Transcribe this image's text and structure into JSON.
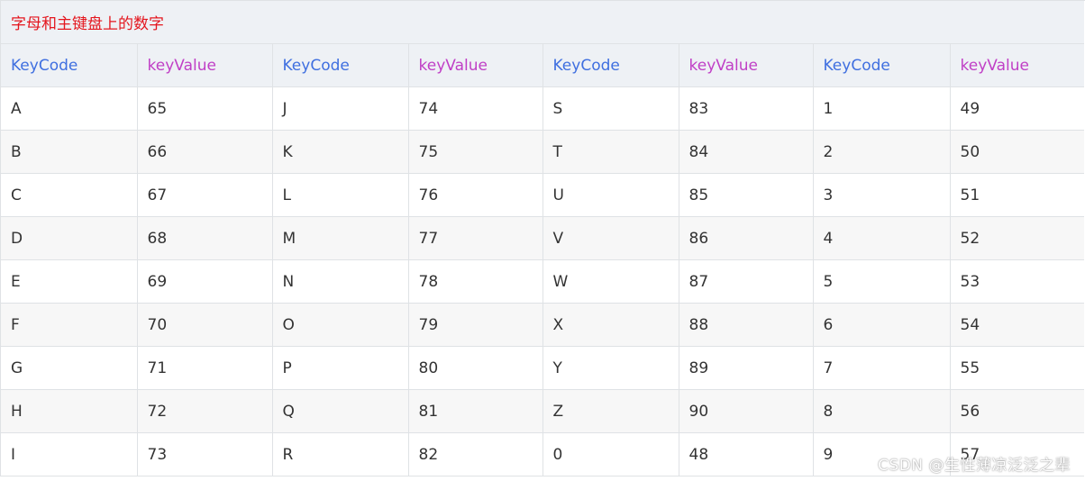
{
  "title": "字母和主键盘上的数字",
  "headers": [
    "KeyCode",
    "keyValue",
    "KeyCode",
    "keyValue",
    "KeyCode",
    "keyValue",
    "KeyCode",
    "keyValue"
  ],
  "rows": [
    [
      "A",
      "65",
      "J",
      "74",
      "S",
      "83",
      "1",
      "49"
    ],
    [
      "B",
      "66",
      "K",
      "75",
      "T",
      "84",
      "2",
      "50"
    ],
    [
      "C",
      "67",
      "L",
      "76",
      "U",
      "85",
      "3",
      "51"
    ],
    [
      "D",
      "68",
      "M",
      "77",
      "V",
      "86",
      "4",
      "52"
    ],
    [
      "E",
      "69",
      "N",
      "78",
      "W",
      "87",
      "5",
      "53"
    ],
    [
      "F",
      "70",
      "O",
      "79",
      "X",
      "88",
      "6",
      "54"
    ],
    [
      "G",
      "71",
      "P",
      "80",
      "Y",
      "89",
      "7",
      "55"
    ],
    [
      "H",
      "72",
      "Q",
      "81",
      "Z",
      "90",
      "8",
      "56"
    ],
    [
      "I",
      "73",
      "R",
      "82",
      "0",
      "48",
      "9",
      "57"
    ]
  ],
  "watermark": "CSDN @生性薄凉泛泛之辈",
  "colors": {
    "title": "#e4161e",
    "keycode_header": "#3f6fe0",
    "keyvalue_header": "#c03fc6",
    "header_bg": "#eef1f5",
    "stripe_bg": "#f7f7f7"
  }
}
